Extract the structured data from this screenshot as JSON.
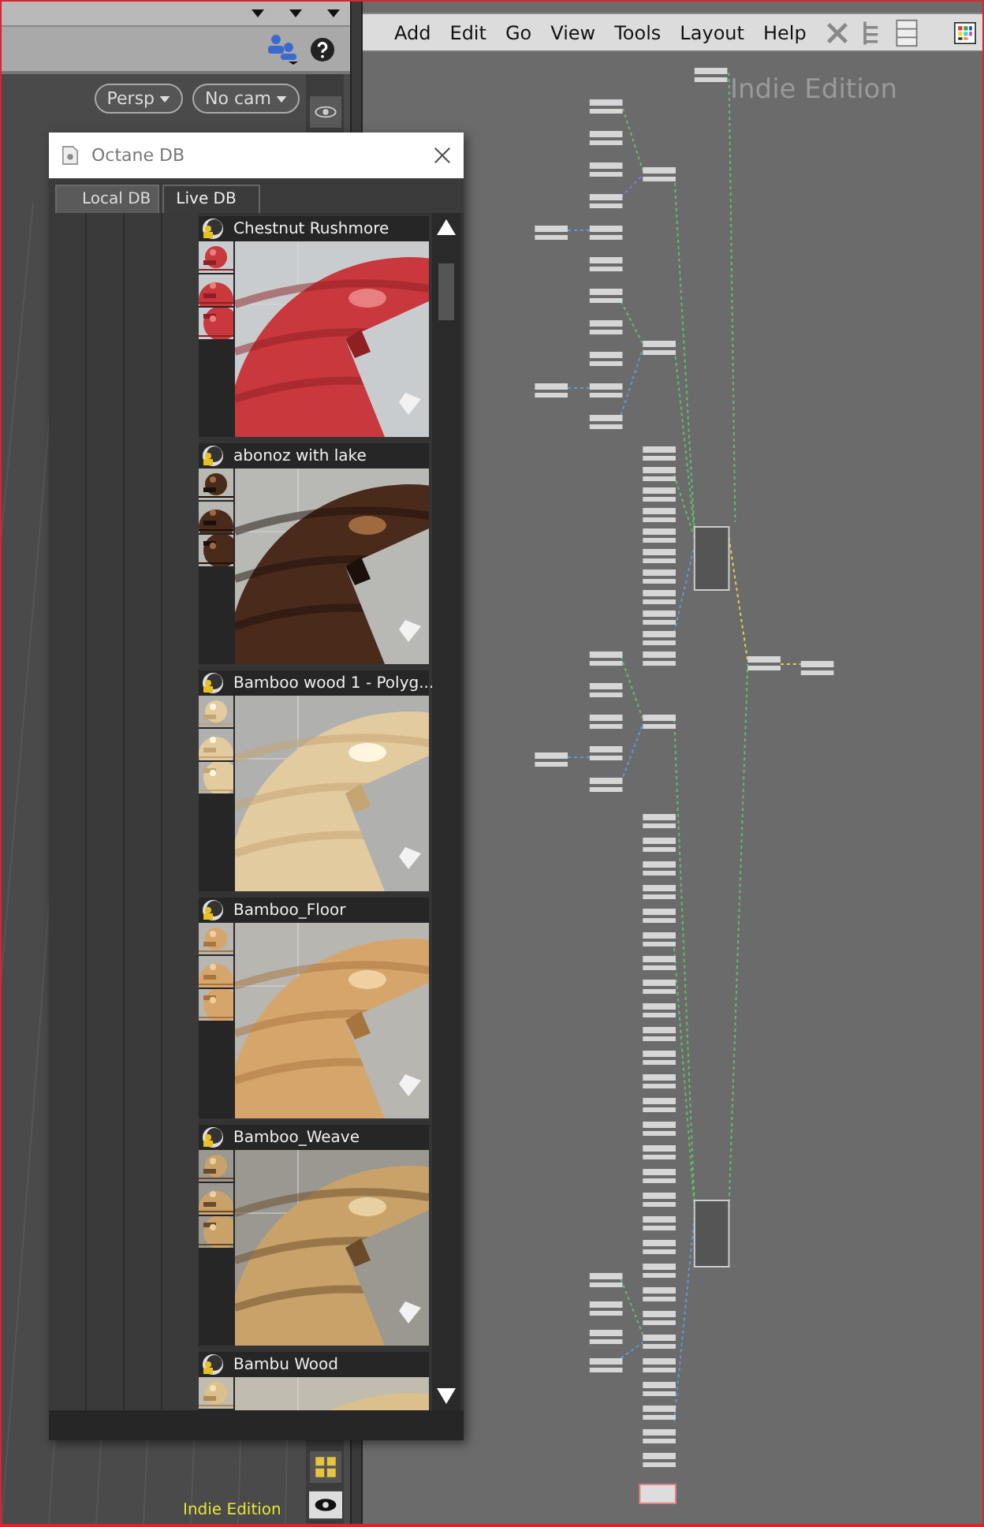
{
  "viewport": {
    "buttons": [
      {
        "label": "Persp"
      },
      {
        "label": "No cam"
      }
    ],
    "watermark": "Indie Edition"
  },
  "octane_db": {
    "title": "Octane DB",
    "tabs": [
      {
        "label": "Local DB",
        "selected": false
      },
      {
        "label": "Live DB",
        "selected": true
      }
    ],
    "materials": [
      {
        "name": "Chestnut Rushmore"
      },
      {
        "name": "abonoz with lake"
      },
      {
        "name": "Bamboo wood 1 - Polyg..."
      },
      {
        "name": "Bamboo_Floor"
      },
      {
        "name": "Bamboo_Weave"
      },
      {
        "name": "Bambu Wood"
      }
    ]
  },
  "node_editor": {
    "menu": [
      "Add",
      "Edit",
      "Go",
      "View",
      "Tools",
      "Layout",
      "Help"
    ],
    "watermark": "Indie Edition"
  }
}
